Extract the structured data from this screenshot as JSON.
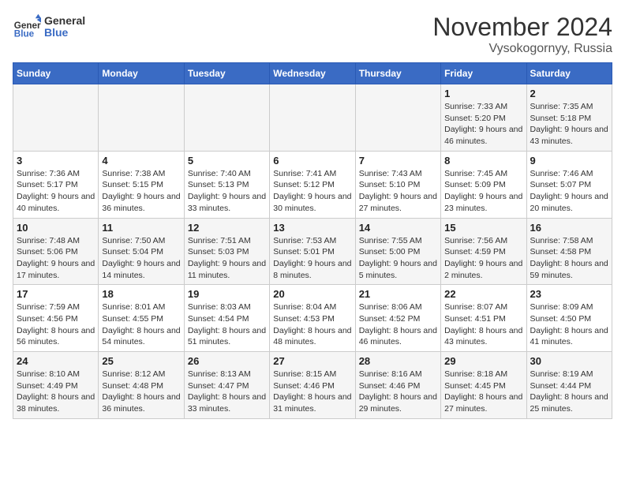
{
  "logo": {
    "text_general": "General",
    "text_blue": "Blue"
  },
  "title": "November 2024",
  "subtitle": "Vysokogornyy, Russia",
  "headers": [
    "Sunday",
    "Monday",
    "Tuesday",
    "Wednesday",
    "Thursday",
    "Friday",
    "Saturday"
  ],
  "weeks": [
    [
      {
        "day": "",
        "info": ""
      },
      {
        "day": "",
        "info": ""
      },
      {
        "day": "",
        "info": ""
      },
      {
        "day": "",
        "info": ""
      },
      {
        "day": "",
        "info": ""
      },
      {
        "day": "1",
        "info": "Sunrise: 7:33 AM\nSunset: 5:20 PM\nDaylight: 9 hours and 46 minutes."
      },
      {
        "day": "2",
        "info": "Sunrise: 7:35 AM\nSunset: 5:18 PM\nDaylight: 9 hours and 43 minutes."
      }
    ],
    [
      {
        "day": "3",
        "info": "Sunrise: 7:36 AM\nSunset: 5:17 PM\nDaylight: 9 hours and 40 minutes."
      },
      {
        "day": "4",
        "info": "Sunrise: 7:38 AM\nSunset: 5:15 PM\nDaylight: 9 hours and 36 minutes."
      },
      {
        "day": "5",
        "info": "Sunrise: 7:40 AM\nSunset: 5:13 PM\nDaylight: 9 hours and 33 minutes."
      },
      {
        "day": "6",
        "info": "Sunrise: 7:41 AM\nSunset: 5:12 PM\nDaylight: 9 hours and 30 minutes."
      },
      {
        "day": "7",
        "info": "Sunrise: 7:43 AM\nSunset: 5:10 PM\nDaylight: 9 hours and 27 minutes."
      },
      {
        "day": "8",
        "info": "Sunrise: 7:45 AM\nSunset: 5:09 PM\nDaylight: 9 hours and 23 minutes."
      },
      {
        "day": "9",
        "info": "Sunrise: 7:46 AM\nSunset: 5:07 PM\nDaylight: 9 hours and 20 minutes."
      }
    ],
    [
      {
        "day": "10",
        "info": "Sunrise: 7:48 AM\nSunset: 5:06 PM\nDaylight: 9 hours and 17 minutes."
      },
      {
        "day": "11",
        "info": "Sunrise: 7:50 AM\nSunset: 5:04 PM\nDaylight: 9 hours and 14 minutes."
      },
      {
        "day": "12",
        "info": "Sunrise: 7:51 AM\nSunset: 5:03 PM\nDaylight: 9 hours and 11 minutes."
      },
      {
        "day": "13",
        "info": "Sunrise: 7:53 AM\nSunset: 5:01 PM\nDaylight: 9 hours and 8 minutes."
      },
      {
        "day": "14",
        "info": "Sunrise: 7:55 AM\nSunset: 5:00 PM\nDaylight: 9 hours and 5 minutes."
      },
      {
        "day": "15",
        "info": "Sunrise: 7:56 AM\nSunset: 4:59 PM\nDaylight: 9 hours and 2 minutes."
      },
      {
        "day": "16",
        "info": "Sunrise: 7:58 AM\nSunset: 4:58 PM\nDaylight: 8 hours and 59 minutes."
      }
    ],
    [
      {
        "day": "17",
        "info": "Sunrise: 7:59 AM\nSunset: 4:56 PM\nDaylight: 8 hours and 56 minutes."
      },
      {
        "day": "18",
        "info": "Sunrise: 8:01 AM\nSunset: 4:55 PM\nDaylight: 8 hours and 54 minutes."
      },
      {
        "day": "19",
        "info": "Sunrise: 8:03 AM\nSunset: 4:54 PM\nDaylight: 8 hours and 51 minutes."
      },
      {
        "day": "20",
        "info": "Sunrise: 8:04 AM\nSunset: 4:53 PM\nDaylight: 8 hours and 48 minutes."
      },
      {
        "day": "21",
        "info": "Sunrise: 8:06 AM\nSunset: 4:52 PM\nDaylight: 8 hours and 46 minutes."
      },
      {
        "day": "22",
        "info": "Sunrise: 8:07 AM\nSunset: 4:51 PM\nDaylight: 8 hours and 43 minutes."
      },
      {
        "day": "23",
        "info": "Sunrise: 8:09 AM\nSunset: 4:50 PM\nDaylight: 8 hours and 41 minutes."
      }
    ],
    [
      {
        "day": "24",
        "info": "Sunrise: 8:10 AM\nSunset: 4:49 PM\nDaylight: 8 hours and 38 minutes."
      },
      {
        "day": "25",
        "info": "Sunrise: 8:12 AM\nSunset: 4:48 PM\nDaylight: 8 hours and 36 minutes."
      },
      {
        "day": "26",
        "info": "Sunrise: 8:13 AM\nSunset: 4:47 PM\nDaylight: 8 hours and 33 minutes."
      },
      {
        "day": "27",
        "info": "Sunrise: 8:15 AM\nSunset: 4:46 PM\nDaylight: 8 hours and 31 minutes."
      },
      {
        "day": "28",
        "info": "Sunrise: 8:16 AM\nSunset: 4:46 PM\nDaylight: 8 hours and 29 minutes."
      },
      {
        "day": "29",
        "info": "Sunrise: 8:18 AM\nSunset: 4:45 PM\nDaylight: 8 hours and 27 minutes."
      },
      {
        "day": "30",
        "info": "Sunrise: 8:19 AM\nSunset: 4:44 PM\nDaylight: 8 hours and 25 minutes."
      }
    ]
  ]
}
